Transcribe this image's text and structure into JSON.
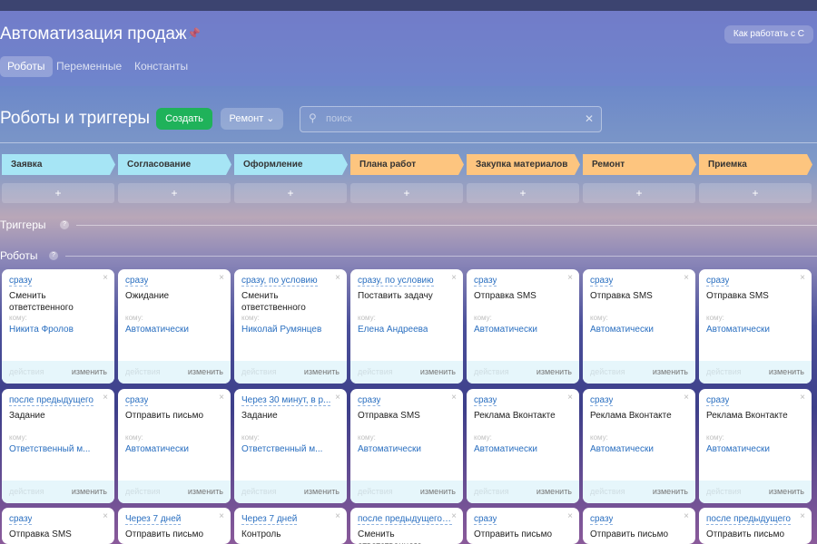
{
  "header": {
    "title": "Автоматизация продаж",
    "help_button": "Как работать с С",
    "tabs": [
      "Роботы",
      "Переменные",
      "Константы"
    ]
  },
  "toolbar": {
    "title": "Роботы и триггеры",
    "create": "Создать",
    "category": "Ремонт",
    "search_placeholder": "поиск"
  },
  "stages": [
    {
      "label": "Заявка",
      "color": "#a6e5f5"
    },
    {
      "label": "Согласование",
      "color": "#a6e5f5"
    },
    {
      "label": "Оформление",
      "color": "#a6e5f5"
    },
    {
      "label": "Плана работ",
      "color": "#fdc57f"
    },
    {
      "label": "Закупка материалов",
      "color": "#fdc57f"
    },
    {
      "label": "Ремонт",
      "color": "#fdc57f"
    },
    {
      "label": "Приемка",
      "color": "#fdc57f"
    }
  ],
  "add_label": "+",
  "sections": {
    "triggers": "Триггеры",
    "robots": "Роботы",
    "help": "?"
  },
  "card_labels": {
    "to": "кому:",
    "actions": "действия",
    "edit": "изменить",
    "close": "×"
  },
  "rows": [
    [
      {
        "when": "сразу",
        "name": "Сменить ответственного",
        "who": "Никита Фролов"
      },
      {
        "when": "сразу",
        "name": "Ожидание",
        "who": "Автоматически"
      },
      {
        "when": "сразу, по условию",
        "name": "Сменить ответственного",
        "who": "Николай Румянцев"
      },
      {
        "when": "сразу, по условию",
        "name": "Поставить задачу",
        "who": "Елена Андреева"
      },
      {
        "when": "сразу",
        "name": "Отправка SMS",
        "who": "Автоматически"
      },
      {
        "when": "сразу",
        "name": "Отправка SMS",
        "who": "Автоматически"
      },
      {
        "when": "сразу",
        "name": "Отправка SMS",
        "who": "Автоматически"
      }
    ],
    [
      {
        "when": "после предыдущего",
        "name": "Задание",
        "who": "Ответственный м..."
      },
      {
        "when": "сразу",
        "name": "Отправить письмо",
        "who": "Автоматически"
      },
      {
        "when": "Через 30 минут, в р...",
        "name": "Задание",
        "who": "Ответственный м..."
      },
      {
        "when": "сразу",
        "name": "Отправка SMS",
        "who": "Автоматически"
      },
      {
        "when": "сразу",
        "name": "Реклама Вконтакте",
        "who": "Автоматически"
      },
      {
        "when": "сразу",
        "name": "Реклама Вконтакте",
        "who": "Автоматически"
      },
      {
        "when": "сразу",
        "name": "Реклама Вконтакте",
        "who": "Автоматически"
      }
    ],
    [
      {
        "when": "сразу",
        "name": "Отправка SMS"
      },
      {
        "when": "Через 7 дней",
        "name": "Отправить письмо"
      },
      {
        "when": "Через 7 дней",
        "name": "Контроль"
      },
      {
        "when": "после предыдущего,...",
        "name": "Сменить ответственного"
      },
      {
        "when": "сразу",
        "name": "Отправить письмо"
      },
      {
        "when": "сразу",
        "name": "Отправить письмо"
      },
      {
        "when": "после предыдущего",
        "name": "Отправить письмо"
      }
    ]
  ]
}
